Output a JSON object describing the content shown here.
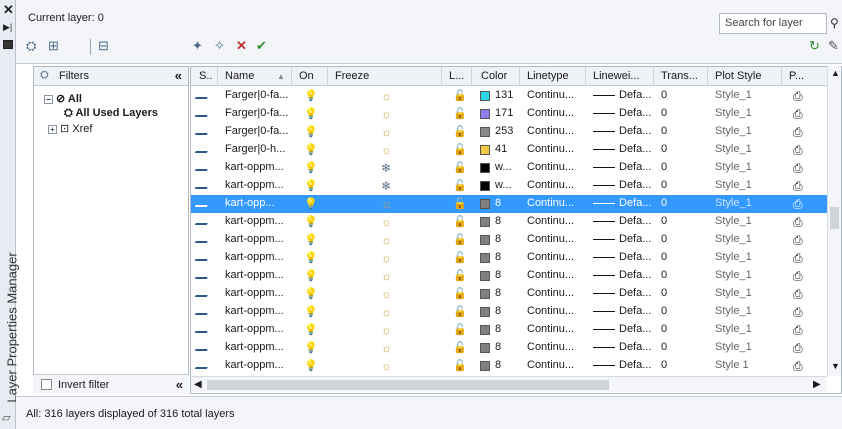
{
  "palette_title": "Layer Properties Manager",
  "current_layer": "Current layer: 0",
  "search": {
    "placeholder": "Search for layer"
  },
  "filters": {
    "header": "Filters",
    "tree": [
      {
        "label": "All",
        "bold": true
      },
      {
        "label": "All Used Layers",
        "bold": true
      },
      {
        "label": "Xref",
        "bold": false
      }
    ],
    "invert_label": "Invert filter"
  },
  "columns": [
    "S..",
    "Name",
    "On",
    "Freeze",
    "L...",
    "Color",
    "Linetype",
    "Linewei...",
    "Trans...",
    "Plot Style",
    "P..."
  ],
  "colors": {
    "selected": "#3399ff",
    "c131": "#2fd8e0",
    "c171": "#8f7fe8",
    "c253": "#8a8a8a",
    "c41": "#f5c842",
    "white": "#000000",
    "c8": "#808080"
  },
  "rows": [
    {
      "name": "Farger|0-fa...",
      "freeze": "sun",
      "color": "131",
      "swatch": "#2fd8e0",
      "linetype": "Continu...",
      "lw": "Defa...",
      "trans": "0",
      "plot": "Style_1",
      "selected": false
    },
    {
      "name": "Farger|0-fa...",
      "freeze": "sun",
      "color": "171",
      "swatch": "#8f7fe8",
      "linetype": "Continu...",
      "lw": "Defa...",
      "trans": "0",
      "plot": "Style_1",
      "selected": false
    },
    {
      "name": "Farger|0-fa...",
      "freeze": "sun",
      "color": "253",
      "swatch": "#8a8a8a",
      "linetype": "Continu...",
      "lw": "Defa...",
      "trans": "0",
      "plot": "Style_1",
      "selected": false
    },
    {
      "name": "Farger|0-h...",
      "freeze": "sun",
      "color": "41",
      "swatch": "#f5c842",
      "linetype": "Continu...",
      "lw": "Defa...",
      "trans": "0",
      "plot": "Style_1",
      "selected": false
    },
    {
      "name": "kart-oppm...",
      "freeze": "flake",
      "color": "w...",
      "swatch": "#000000",
      "linetype": "Continu...",
      "lw": "Defa...",
      "trans": "0",
      "plot": "Style_1",
      "selected": false
    },
    {
      "name": "kart-oppm...",
      "freeze": "flake",
      "color": "w...",
      "swatch": "#000000",
      "linetype": "Continu...",
      "lw": "Defa...",
      "trans": "0",
      "plot": "Style_1",
      "selected": false
    },
    {
      "name": "kart-opp...",
      "freeze": "sun",
      "color": "8",
      "swatch": "#808080",
      "linetype": "Continu...",
      "lw": "Defa...",
      "trans": "0",
      "plot": "Style_1",
      "selected": true
    },
    {
      "name": "kart-oppm...",
      "freeze": "sun",
      "color": "8",
      "swatch": "#808080",
      "linetype": "Continu...",
      "lw": "Defa...",
      "trans": "0",
      "plot": "Style_1",
      "selected": false
    },
    {
      "name": "kart-oppm...",
      "freeze": "sun",
      "color": "8",
      "swatch": "#808080",
      "linetype": "Continu...",
      "lw": "Defa...",
      "trans": "0",
      "plot": "Style_1",
      "selected": false
    },
    {
      "name": "kart-oppm...",
      "freeze": "sun",
      "color": "8",
      "swatch": "#808080",
      "linetype": "Continu...",
      "lw": "Defa...",
      "trans": "0",
      "plot": "Style_1",
      "selected": false
    },
    {
      "name": "kart-oppm...",
      "freeze": "sun",
      "color": "8",
      "swatch": "#808080",
      "linetype": "Continu...",
      "lw": "Defa...",
      "trans": "0",
      "plot": "Style_1",
      "selected": false
    },
    {
      "name": "kart-oppm...",
      "freeze": "sun",
      "color": "8",
      "swatch": "#808080",
      "linetype": "Continu...",
      "lw": "Defa...",
      "trans": "0",
      "plot": "Style_1",
      "selected": false
    },
    {
      "name": "kart-oppm...",
      "freeze": "sun",
      "color": "8",
      "swatch": "#808080",
      "linetype": "Continu...",
      "lw": "Defa...",
      "trans": "0",
      "plot": "Style_1",
      "selected": false
    },
    {
      "name": "kart-oppm...",
      "freeze": "sun",
      "color": "8",
      "swatch": "#808080",
      "linetype": "Continu...",
      "lw": "Defa...",
      "trans": "0",
      "plot": "Style_1",
      "selected": false
    },
    {
      "name": "kart-oppm...",
      "freeze": "sun",
      "color": "8",
      "swatch": "#808080",
      "linetype": "Continu...",
      "lw": "Defa...",
      "trans": "0",
      "plot": "Style_1",
      "selected": false
    },
    {
      "name": "kart-oppm...",
      "freeze": "sun",
      "color": "8",
      "swatch": "#808080",
      "linetype": "Continu...",
      "lw": "Defa...",
      "trans": "0",
      "plot": "Style 1",
      "selected": false
    }
  ],
  "status": "All: 316 layers displayed of 316 total layers"
}
